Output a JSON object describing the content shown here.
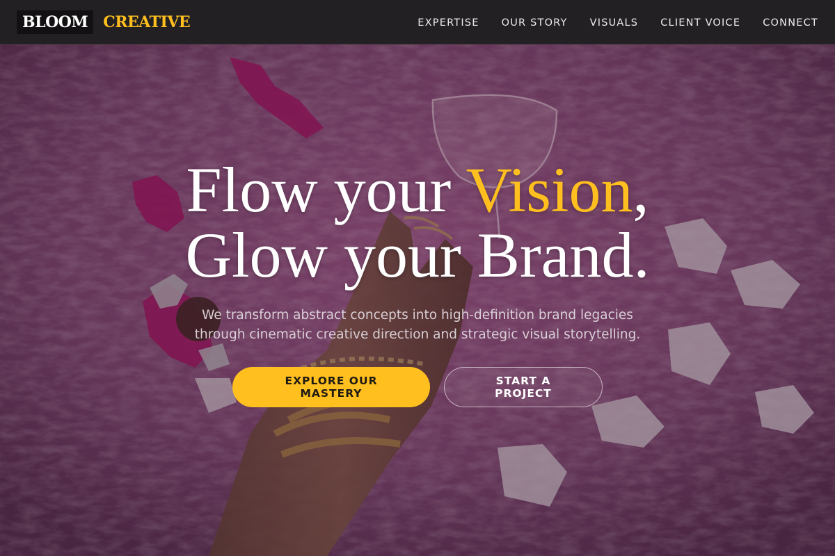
{
  "brand": {
    "part1": "BLOOM",
    "part2": "CREATIVE"
  },
  "nav": {
    "items": [
      {
        "label": "EXPERTISE"
      },
      {
        "label": "OUR STORY"
      },
      {
        "label": "VISUALS"
      },
      {
        "label": "CLIENT VOICE"
      },
      {
        "label": "CONNECT"
      }
    ]
  },
  "hero": {
    "headline_1_pre": "Flow your ",
    "headline_1_accent": "Vision",
    "headline_1_post": ",",
    "headline_2": "Glow your Brand.",
    "subtitle_line1": "We transform abstract concepts into high-definition brand legacies",
    "subtitle_line2": "through cinematic creative direction and strategic visual storytelling.",
    "primary_cta": "EXPLORE OUR MASTERY",
    "secondary_cta": "START A PROJECT",
    "background_image": "hand-with-gold-bracelets-on-pink-fur-photo"
  },
  "colors": {
    "accent": "#ffbf1f",
    "nav_background": "#232023",
    "hero_tint": "#7a3a66"
  }
}
